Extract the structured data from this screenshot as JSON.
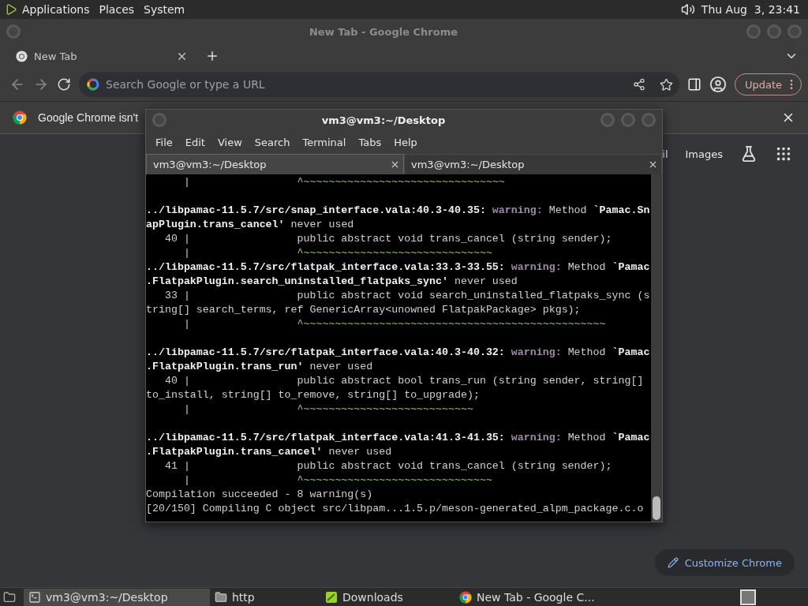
{
  "top_panel": {
    "menus": [
      "Applications",
      "Places",
      "System"
    ],
    "clock": "Thu Aug  3, 23:41"
  },
  "browser": {
    "title": "New Tab - Google Chrome",
    "tabs": [
      {
        "label": "New Tab",
        "selected": true
      }
    ],
    "address_placeholder": "Search Google or type a URL",
    "update_button": "Update",
    "infobar": {
      "message": "Google Chrome isn't"
    },
    "page_links": [
      "il",
      "Images"
    ],
    "customize_button": "Customize Chrome"
  },
  "terminal": {
    "title": "vm3@vm3:~/Desktop",
    "menus": [
      "File",
      "Edit",
      "View",
      "Search",
      "Terminal",
      "Tabs",
      "Help"
    ],
    "tabs": [
      {
        "label": "vm3@vm3:~/Desktop",
        "selected": true
      },
      {
        "label": "vm3@vm3:~/Desktop",
        "selected": false
      }
    ],
    "lines": [
      {
        "kind": "text",
        "segments": [
          {
            "kind": "plain",
            "text": "      |                 "
          },
          {
            "kind": "caret",
            "text": "^~~~~~~~~~~~~~~~~~~~~~~~~~~~~~~~~"
          }
        ]
      },
      {
        "kind": "blank"
      },
      {
        "kind": "text",
        "segments": [
          {
            "kind": "bold",
            "text": "../libpamac-11.5.7/src/snap_interface.vala:40.3-40.35:"
          },
          {
            "kind": "warning",
            "text": " warning:"
          },
          {
            "kind": "plain",
            "text": " Method "
          },
          {
            "kind": "bold",
            "text": "`Pamac.Sn"
          }
        ]
      },
      {
        "kind": "text",
        "segments": [
          {
            "kind": "bold",
            "text": "apPlugin.trans_cancel'"
          },
          {
            "kind": "plain",
            "text": " never used"
          }
        ]
      },
      {
        "kind": "text",
        "segments": [
          {
            "kind": "plain",
            "text": "   40 |                 public abstract void trans_cancel (string sender);"
          }
        ]
      },
      {
        "kind": "text",
        "segments": [
          {
            "kind": "plain",
            "text": "      |                 "
          },
          {
            "kind": "caret",
            "text": "^~~~~~~~~~~~~~~~~~~~~~~~~~~~~~~"
          }
        ]
      },
      {
        "kind": "text",
        "segments": [
          {
            "kind": "bold",
            "text": "../libpamac-11.5.7/src/flatpak_interface.vala:33.3-33.55:"
          },
          {
            "kind": "warning",
            "text": " warning:"
          },
          {
            "kind": "plain",
            "text": " Method "
          },
          {
            "kind": "bold",
            "text": "`Pamac"
          }
        ]
      },
      {
        "kind": "text",
        "segments": [
          {
            "kind": "bold",
            "text": ".FlatpakPlugin.search_uninstalled_flatpaks_sync'"
          },
          {
            "kind": "plain",
            "text": " never used"
          }
        ]
      },
      {
        "kind": "text",
        "segments": [
          {
            "kind": "plain",
            "text": "   33 |                 public abstract void search_uninstalled_flatpaks_sync (s"
          }
        ]
      },
      {
        "kind": "text",
        "segments": [
          {
            "kind": "plain",
            "text": "tring[] search_terms, ref GenericArray<unowned FlatpakPackage> pkgs);"
          }
        ]
      },
      {
        "kind": "text",
        "segments": [
          {
            "kind": "plain",
            "text": "      |                 "
          },
          {
            "kind": "caret",
            "text": "^~~~~~~~~~~~~~~~~~~~~~~~~~~~~~~~~~~~~~~~~~~~~~~~~"
          }
        ]
      },
      {
        "kind": "blank"
      },
      {
        "kind": "text",
        "segments": [
          {
            "kind": "bold",
            "text": "../libpamac-11.5.7/src/flatpak_interface.vala:40.3-40.32:"
          },
          {
            "kind": "warning",
            "text": " warning:"
          },
          {
            "kind": "plain",
            "text": " Method "
          },
          {
            "kind": "bold",
            "text": "`Pamac"
          }
        ]
      },
      {
        "kind": "text",
        "segments": [
          {
            "kind": "bold",
            "text": ".FlatpakPlugin.trans_run'"
          },
          {
            "kind": "plain",
            "text": " never used"
          }
        ]
      },
      {
        "kind": "text",
        "segments": [
          {
            "kind": "plain",
            "text": "   40 |                 public abstract bool trans_run (string sender, string[]"
          }
        ]
      },
      {
        "kind": "text",
        "segments": [
          {
            "kind": "plain",
            "text": "to_install, string[] to_remove, string[] to_upgrade);"
          }
        ]
      },
      {
        "kind": "text",
        "segments": [
          {
            "kind": "plain",
            "text": "      |                 "
          },
          {
            "kind": "caret",
            "text": "^~~~~~~~~~~~~~~~~~~~~~~~~~~~"
          }
        ]
      },
      {
        "kind": "blank"
      },
      {
        "kind": "text",
        "segments": [
          {
            "kind": "bold",
            "text": "../libpamac-11.5.7/src/flatpak_interface.vala:41.3-41.35:"
          },
          {
            "kind": "warning",
            "text": " warning:"
          },
          {
            "kind": "plain",
            "text": " Method "
          },
          {
            "kind": "bold",
            "text": "`Pamac"
          }
        ]
      },
      {
        "kind": "text",
        "segments": [
          {
            "kind": "bold",
            "text": ".FlatpakPlugin.trans_cancel'"
          },
          {
            "kind": "plain",
            "text": " never used"
          }
        ]
      },
      {
        "kind": "text",
        "segments": [
          {
            "kind": "plain",
            "text": "   41 |                 public abstract void trans_cancel (string sender);"
          }
        ]
      },
      {
        "kind": "text",
        "segments": [
          {
            "kind": "plain",
            "text": "      |                 "
          },
          {
            "kind": "caret",
            "text": "^~~~~~~~~~~~~~~~~~~~~~~~~~~~~~~"
          }
        ]
      },
      {
        "kind": "text",
        "segments": [
          {
            "kind": "plain",
            "text": "Compilation succeeded - 8 warning(s)"
          }
        ]
      },
      {
        "kind": "text",
        "segments": [
          {
            "kind": "plain",
            "text": "[20/150] Compiling C object src/libpam...1.5.p/meson-generated_alpm_package.c.o"
          }
        ]
      }
    ]
  },
  "taskbar": {
    "items": [
      {
        "kind": "terminal",
        "label": "vm3@vm3:~/Desktop",
        "selected": true
      },
      {
        "kind": "folder",
        "label": "http",
        "selected": false
      },
      {
        "kind": "downloads",
        "label": "Downloads",
        "selected": false
      },
      {
        "kind": "chrome",
        "label": "New Tab - Google C...",
        "selected": false
      }
    ]
  }
}
